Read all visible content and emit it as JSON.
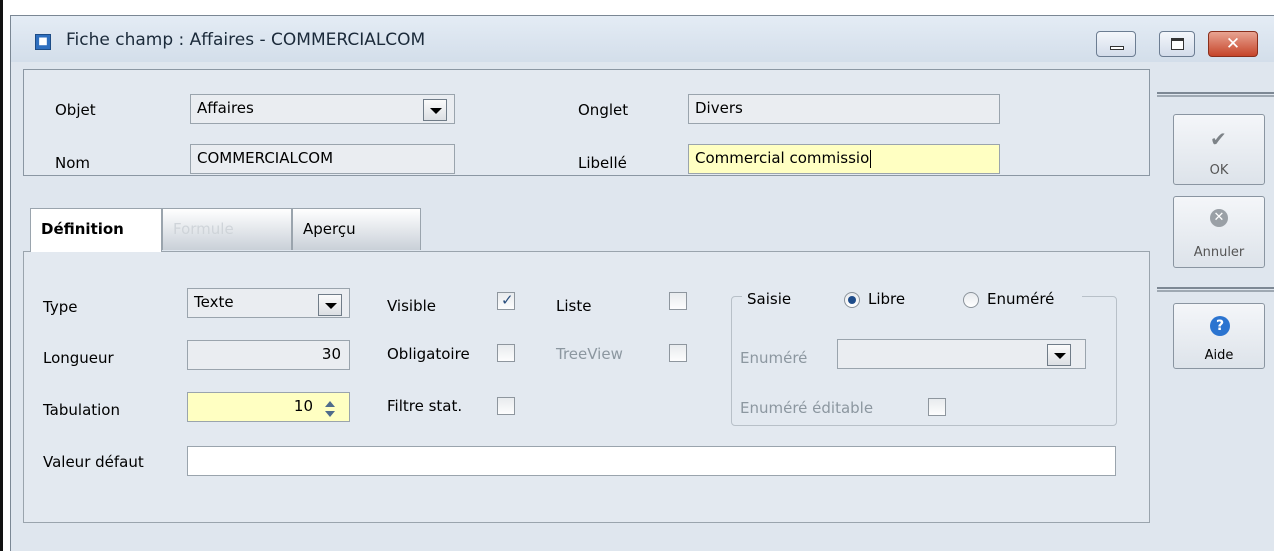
{
  "window": {
    "title": "Fiche champ : Affaires - COMMERCIALCOM",
    "app_icon": "record-icon",
    "close_glyph": "✕"
  },
  "header": {
    "objet_label": "Objet",
    "objet_value": "Affaires",
    "nom_label": "Nom",
    "nom_value": "COMMERCIALCOM",
    "onglet_label": "Onglet",
    "onglet_value": "Divers",
    "libelle_label": "Libellé",
    "libelle_value": "Commercial commissio"
  },
  "tabs": [
    {
      "label": "Définition",
      "state": "active"
    },
    {
      "label": "Formule",
      "state": "disabled"
    },
    {
      "label": "Aperçu",
      "state": "normal"
    }
  ],
  "definition": {
    "type_label": "Type",
    "type_value": "Texte",
    "longueur_label": "Longueur",
    "longueur_value": "30",
    "tabulation_label": "Tabulation",
    "tabulation_value": "10",
    "valeur_defaut_label": "Valeur défaut",
    "valeur_defaut_value": "",
    "visible_label": "Visible",
    "visible_checked": true,
    "obligatoire_label": "Obligatoire",
    "obligatoire_checked": false,
    "filtre_label": "Filtre stat.",
    "filtre_checked": false,
    "liste_label": "Liste",
    "liste_checked": false,
    "treeview_label": "TreeView",
    "treeview_checked": false
  },
  "saisie": {
    "group_label": "Saisie",
    "libre_label": "Libre",
    "libre_selected": true,
    "enumere_radio_label": "Enuméré",
    "enumere_field_label": "Enuméré",
    "enumere_value": "",
    "enumere_editable_label": "Enuméré éditable",
    "enumere_editable_checked": false
  },
  "actions": {
    "ok_label": "OK",
    "annuler_label": "Annuler",
    "aide_label": "Aide",
    "ok_icon_glyph": "✔",
    "annuler_icon_glyph": "✕",
    "aide_icon_glyph": "?"
  },
  "colors": {
    "required_field": "#ffffc2",
    "window_bg": "#dfe6ee"
  }
}
